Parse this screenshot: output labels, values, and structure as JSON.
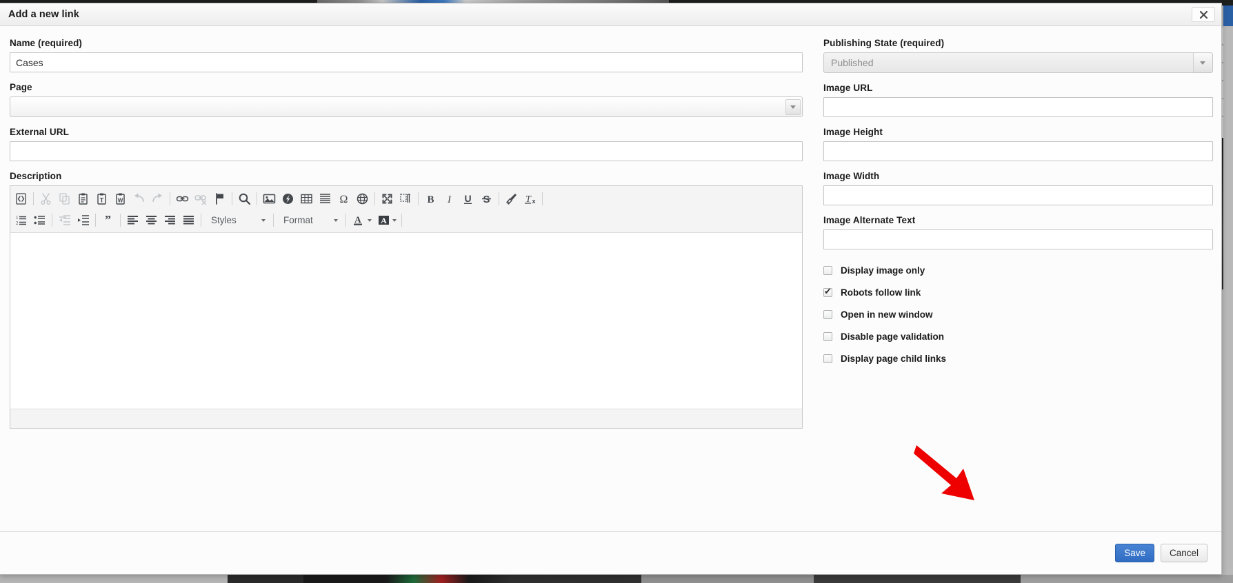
{
  "dialog": {
    "title": "Add a new link",
    "close_icon": "close-icon"
  },
  "left_fields": {
    "name": {
      "label": "Name (required)",
      "value": "Cases",
      "placeholder": ""
    },
    "page": {
      "label": "Page",
      "value": "",
      "placeholder": ""
    },
    "external_url": {
      "label": "External URL",
      "value": "",
      "placeholder": ""
    },
    "description": {
      "label": "Description"
    }
  },
  "right_fields": {
    "publishing_state": {
      "label": "Publishing State (required)",
      "value": "Published",
      "disabled": true
    },
    "image_url": {
      "label": "Image URL",
      "value": "",
      "placeholder": ""
    },
    "image_height": {
      "label": "Image Height",
      "value": "",
      "placeholder": ""
    },
    "image_width": {
      "label": "Image Width",
      "value": "",
      "placeholder": ""
    },
    "image_alt_text": {
      "label": "Image Alternate Text",
      "value": "",
      "placeholder": ""
    }
  },
  "checkboxes": [
    {
      "label": "Display image only",
      "checked": false
    },
    {
      "label": "Robots follow link",
      "checked": true
    },
    {
      "label": "Open in new window",
      "checked": false
    },
    {
      "label": "Disable page validation",
      "checked": false
    },
    {
      "label": "Display page child links",
      "checked": false
    }
  ],
  "editor": {
    "toolbar_row1": [
      {
        "name": "source-icon",
        "title": "Source",
        "disabled": false
      },
      {
        "sep": true
      },
      {
        "name": "cut-icon",
        "title": "Cut",
        "disabled": true
      },
      {
        "name": "copy-icon",
        "title": "Copy",
        "disabled": true
      },
      {
        "name": "paste-icon",
        "title": "Paste",
        "disabled": false
      },
      {
        "name": "paste-as-text-icon",
        "title": "Paste as plain text",
        "disabled": false
      },
      {
        "name": "paste-from-word-icon",
        "title": "Paste from Word",
        "disabled": false
      },
      {
        "name": "undo-icon",
        "title": "Undo",
        "disabled": true
      },
      {
        "name": "redo-icon",
        "title": "Redo",
        "disabled": true
      },
      {
        "sep": true
      },
      {
        "name": "link-icon",
        "title": "Link",
        "disabled": false
      },
      {
        "name": "unlink-icon",
        "title": "Unlink",
        "disabled": true
      },
      {
        "name": "anchor-flag-icon",
        "title": "Anchor",
        "disabled": false
      },
      {
        "sep": true
      },
      {
        "name": "search-icon",
        "title": "Find",
        "disabled": false
      },
      {
        "sep": true
      },
      {
        "name": "image-icon",
        "title": "Image",
        "disabled": false
      },
      {
        "name": "flash-icon",
        "title": "Flash",
        "disabled": false
      },
      {
        "name": "table-icon",
        "title": "Table",
        "disabled": false
      },
      {
        "name": "horizontal-rule-icon",
        "title": "Horizontal Line",
        "disabled": false
      },
      {
        "name": "special-char-icon",
        "title": "Special Character",
        "disabled": false
      },
      {
        "name": "iframe-globe-icon",
        "title": "IFrame",
        "disabled": false
      },
      {
        "sep": true
      },
      {
        "name": "maximize-icon",
        "title": "Maximize",
        "disabled": false
      },
      {
        "name": "show-blocks-icon",
        "title": "Show Blocks",
        "disabled": false
      },
      {
        "sep": true
      },
      {
        "name": "bold-icon",
        "title": "Bold",
        "disabled": false
      },
      {
        "name": "italic-icon",
        "title": "Italic",
        "disabled": false
      },
      {
        "name": "underline-icon",
        "title": "Underline",
        "disabled": false
      },
      {
        "name": "strikethrough-icon",
        "title": "Strike Through",
        "disabled": false
      },
      {
        "sep": true
      },
      {
        "name": "copy-formatting-brush-icon",
        "title": "Copy Formatting",
        "disabled": false
      },
      {
        "name": "remove-format-icon",
        "title": "Remove Format",
        "disabled": false
      },
      {
        "sep": true
      }
    ],
    "toolbar_row2": [
      {
        "name": "numbered-list-icon",
        "title": "Insert/Remove Numbered List",
        "disabled": false
      },
      {
        "name": "bulleted-list-icon",
        "title": "Insert/Remove Bulleted List",
        "disabled": false
      },
      {
        "sep": true
      },
      {
        "name": "decrease-indent-icon",
        "title": "Decrease Indent",
        "disabled": true
      },
      {
        "name": "increase-indent-icon",
        "title": "Increase Indent",
        "disabled": false
      },
      {
        "sep": true
      },
      {
        "name": "blockquote-icon",
        "title": "Block Quote",
        "disabled": false
      },
      {
        "sep": true
      },
      {
        "name": "align-left-icon",
        "title": "Align Left",
        "disabled": false
      },
      {
        "name": "align-center-icon",
        "title": "Center",
        "disabled": false
      },
      {
        "name": "align-right-icon",
        "title": "Align Right",
        "disabled": false
      },
      {
        "name": "align-justify-icon",
        "title": "Justify",
        "disabled": false
      },
      {
        "sep": true
      }
    ],
    "styles_label": "Styles",
    "format_label": "Format",
    "text_color_label": "A",
    "bg_color_label": "A",
    "body_text": ""
  },
  "footer": {
    "save_label": "Save",
    "cancel_label": "Cancel"
  },
  "colors": {
    "primary": "#2f6cc2",
    "annotation": "#ee0000",
    "dialog_bg": "#fcfcfc",
    "toolbar_bg": "#f4f4f4"
  },
  "annotation": {
    "arrow": "red-arrow-pointing-to-save-button"
  }
}
